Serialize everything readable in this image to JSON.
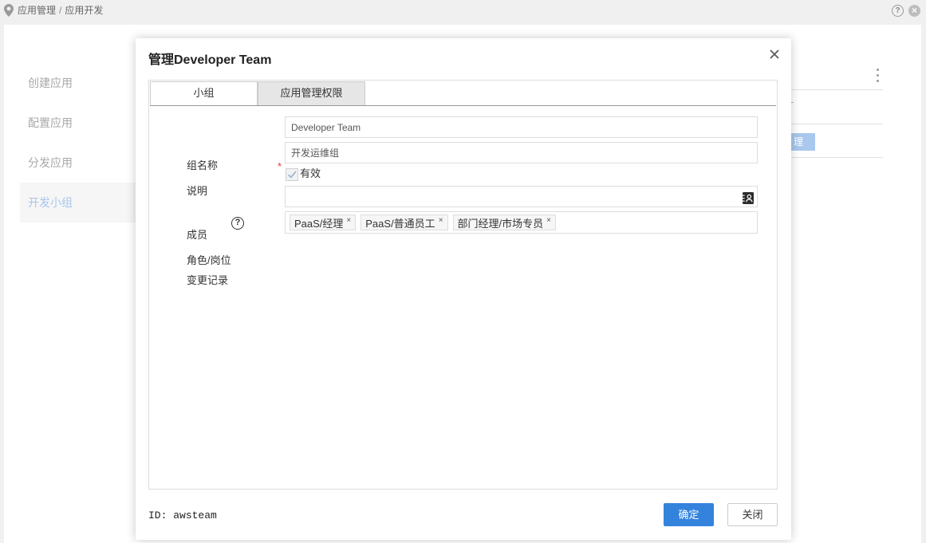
{
  "colors": {
    "accent": "#3383dc",
    "required": "#e53935",
    "sidebar_active_text": "#a6c6ee",
    "background_button": "#a9c8ee"
  },
  "icons": {
    "breadcrumb": "location-pin-icon",
    "modal_close": "close-icon",
    "member_picker": "address-book-icon",
    "checkbox": "checkbox-icon",
    "more": "vertical-ellipsis-icon"
  },
  "breadcrumb": {
    "items": [
      "应用管理",
      "应用开发"
    ],
    "separator": "/"
  },
  "top_actions": {
    "help_glyph": "?",
    "close_glyph": "×"
  },
  "sidebar": {
    "items": [
      {
        "label": "创建应用",
        "active": false
      },
      {
        "label": "配置应用",
        "active": false
      },
      {
        "label": "分发应用",
        "active": false
      },
      {
        "label": "开发小组",
        "active": true
      }
    ]
  },
  "background_content": {
    "dash": "-",
    "action_button_text": "理"
  },
  "modal": {
    "title": "管理Developer Team",
    "tabs": [
      {
        "label": "小组",
        "active": true
      },
      {
        "label": "应用管理权限",
        "active": false
      }
    ],
    "form": {
      "group_name": {
        "label": "组名称",
        "required_mark": "*",
        "value": "Developer Team"
      },
      "description": {
        "label": "说明",
        "value": "开发运维组"
      },
      "enabled": {
        "label": "有效",
        "checked": true
      },
      "members": {
        "label": "成员",
        "value": ""
      },
      "roles": {
        "label": "角色/岗位",
        "help_glyph": "?",
        "remove_glyph": "×",
        "tags": [
          "PaaS/经理",
          "PaaS/普通员工",
          "部门经理/市场专员"
        ]
      },
      "change_log": {
        "label": "变更记录"
      }
    },
    "footer": {
      "id_label": "ID:",
      "id_value": "awsteam",
      "confirm_label": "确定",
      "close_label": "关闭"
    }
  }
}
